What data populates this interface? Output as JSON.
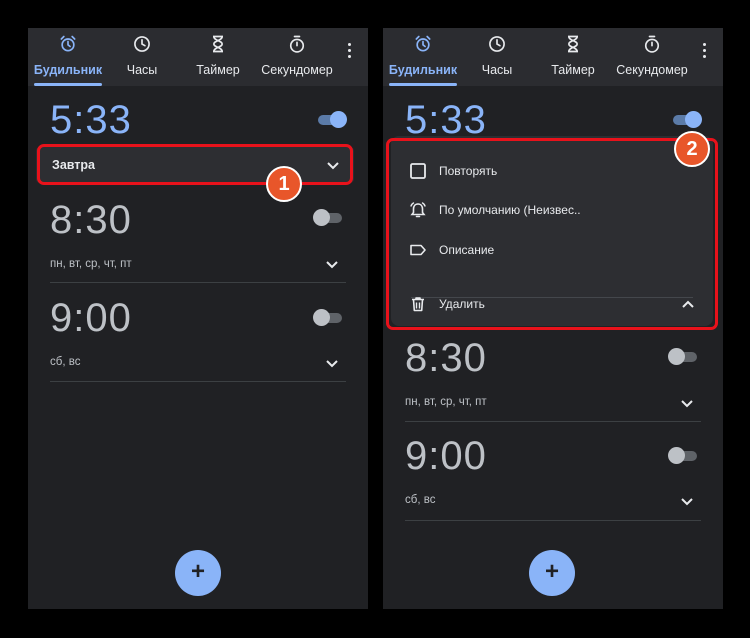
{
  "tabs": [
    {
      "label": "Будильник",
      "icon": "alarm-icon",
      "active": true
    },
    {
      "label": "Часы",
      "icon": "clock-icon",
      "active": false
    },
    {
      "label": "Таймер",
      "icon": "hourglass-icon",
      "active": false
    },
    {
      "label": "Секундомер",
      "icon": "stopwatch-icon",
      "active": false
    }
  ],
  "alarms": [
    {
      "time": "5:33",
      "enabled": true,
      "schedule": "Завтра"
    },
    {
      "time": "8:30",
      "enabled": false,
      "schedule": "пн, вт, ср, чт, пт"
    },
    {
      "time": "9:00",
      "enabled": false,
      "schedule": "сб, вс"
    }
  ],
  "expanded_menu": {
    "repeat_label": "Повторять",
    "sound_label": "По умолчанию (Неизвес..",
    "description_label": "Описание",
    "delete_label": "Удалить"
  },
  "fab": {
    "label": "+"
  },
  "annotations": {
    "step1": "1",
    "step2": "2"
  },
  "colors": {
    "accent": "#8ab4f8",
    "background": "#202124",
    "card": "#2d2e32",
    "highlight": "#e8121b",
    "badge": "#e8562a"
  }
}
